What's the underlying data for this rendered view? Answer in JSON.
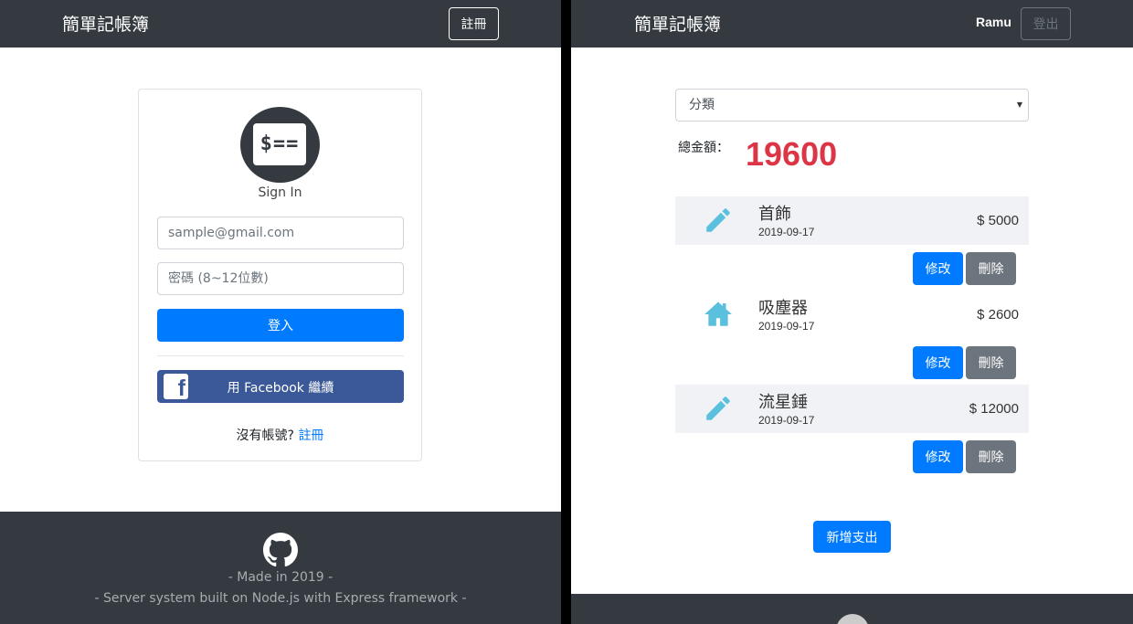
{
  "left": {
    "navbar": {
      "brand": "簡單記帳簿",
      "register_label": "註冊"
    },
    "signin": {
      "logo_text": "$==",
      "title": "Sign In",
      "email_placeholder": "sample@gmail.com",
      "password_placeholder": "密碼 (8~12位數)",
      "login_label": "登入",
      "facebook_label": "用 Facebook 繼續",
      "no_account_text": "沒有帳號?",
      "register_link": "註冊"
    },
    "footer": {
      "made_in": "- Made in 2019 -",
      "tagline": "- Server system built on Node.js with Express framework -"
    }
  },
  "right": {
    "navbar": {
      "brand": "簡單記帳簿",
      "user": "Ramu",
      "logout_label": "登出"
    },
    "filter": {
      "selected": "分類"
    },
    "total": {
      "label": "總金額：",
      "value": "19600"
    },
    "records": [
      {
        "name": "首飾",
        "date": "2019-09-17",
        "amount": "$ 5000",
        "icon": "pencil-icon",
        "edit_label": "修改",
        "delete_label": "刪除"
      },
      {
        "name": "吸塵器",
        "date": "2019-09-17",
        "amount": "$ 2600",
        "icon": "home-icon",
        "edit_label": "修改",
        "delete_label": "刪除"
      },
      {
        "name": "流星錘",
        "date": "2019-09-17",
        "amount": "$ 12000",
        "icon": "pencil-icon",
        "edit_label": "修改",
        "delete_label": "刪除"
      }
    ],
    "add_label": "新增支出"
  },
  "colors": {
    "navbar": "#343a40",
    "primary": "#007bff",
    "secondary": "#6c757d",
    "facebook": "#3b5998",
    "total": "#dc3545",
    "icon": "#5bc0de"
  }
}
